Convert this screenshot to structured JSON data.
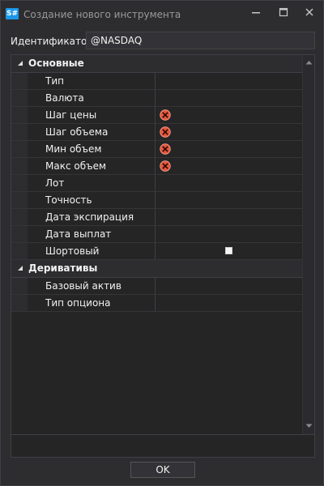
{
  "window": {
    "app_icon_text": "S#",
    "title": "Создание нового инструмента"
  },
  "identifier": {
    "label": "Идентификатор:",
    "value": "@NASDAQ"
  },
  "property_grid": {
    "categories": [
      {
        "label": "Основные",
        "rows": [
          {
            "label": "Тип"
          },
          {
            "label": "Валюта"
          },
          {
            "label": "Шаг цены",
            "error": true
          },
          {
            "label": "Шаг объема",
            "error": true
          },
          {
            "label": "Мин объем",
            "error": true
          },
          {
            "label": "Макс объем",
            "error": true
          },
          {
            "label": "Лот"
          },
          {
            "label": "Точность"
          },
          {
            "label": "Дата экспирация"
          },
          {
            "label": "Дата выплат"
          },
          {
            "label": "Шортовый",
            "checkbox": false
          }
        ]
      },
      {
        "label": "Деривативы",
        "rows": [
          {
            "label": "Базовый актив"
          },
          {
            "label": "Тип опциона"
          }
        ]
      }
    ]
  },
  "buttons": {
    "ok": "OK"
  },
  "colors": {
    "accent": "#1c97ea",
    "error": "#e6563b",
    "background": "#2d2d30",
    "grid_background": "#252526"
  },
  "icons": {
    "error": "error-x-circle-icon",
    "minimize": "minimize-icon",
    "maximize": "maximize-icon",
    "close": "close-icon"
  }
}
